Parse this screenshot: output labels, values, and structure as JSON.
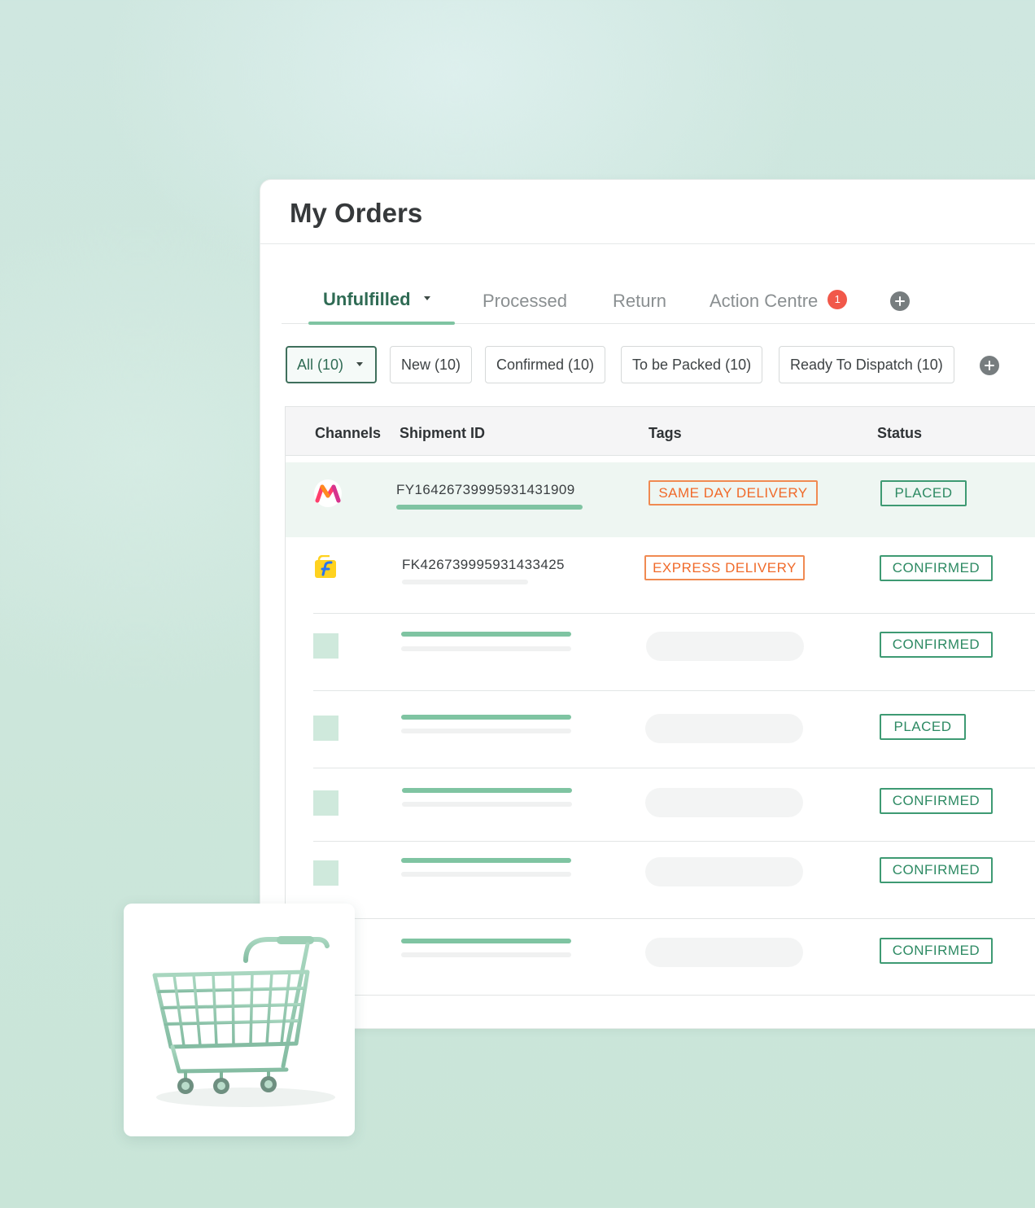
{
  "page": {
    "title": "My Orders"
  },
  "tabs": [
    {
      "label": "Unfulfilled",
      "active": true
    },
    {
      "label": "Processed"
    },
    {
      "label": "Return"
    },
    {
      "label": "Action Centre",
      "badge": "1"
    }
  ],
  "filters": [
    {
      "label": "All (10)",
      "active": true
    },
    {
      "label": "New (10)"
    },
    {
      "label": "Confirmed (10)"
    },
    {
      "label": "To be Packed (10)"
    },
    {
      "label": "Ready To Dispatch (10)"
    }
  ],
  "table": {
    "columns": [
      "Channels",
      "Shipment ID",
      "Tags",
      "Status"
    ],
    "rows": [
      {
        "channel": "myntra-logo",
        "shipment_id": "FY16426739995931431909",
        "tag": "SAME DAY DELIVERY",
        "status": "PLACED"
      },
      {
        "channel": "flipkart-logo",
        "shipment_id": "FK426739995931433425",
        "tag": "EXPRESS DELIVERY",
        "status": "CONFIRMED"
      },
      {
        "status": "CONFIRMED"
      },
      {
        "status": "PLACED"
      },
      {
        "status": "CONFIRMED"
      },
      {
        "status": "CONFIRMED"
      },
      {
        "status": "CONFIRMED"
      }
    ]
  },
  "colors": {
    "accent": "#7fc4a2",
    "active_text": "#2f6b54",
    "tag": "#f06a2a",
    "status": "#2d8a63",
    "badge": "#f1584a"
  },
  "icons": {
    "add_tab": "plus-circle-icon",
    "add_filter": "plus-circle-icon",
    "illustration": "shopping-cart-icon"
  }
}
